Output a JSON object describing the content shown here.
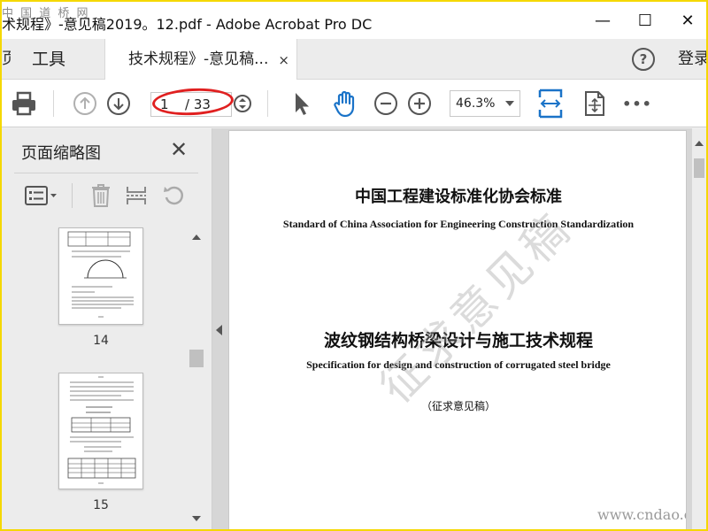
{
  "watermark_site_top": "中 国 道 桥 网",
  "window": {
    "title": "术规程》-意见稿2019。12.pdf - Adobe Acrobat Pro DC",
    "minimize_glyph": "—",
    "maximize_glyph": "☐",
    "close_glyph": "✕"
  },
  "tabs": {
    "home_partial": "页",
    "tools": "工具",
    "document": "技术规程》-意见稿...",
    "close_glyph": "×",
    "help_glyph": "?",
    "login": "登录"
  },
  "toolbar": {
    "icons": [
      "print-icon",
      "page-up-icon",
      "page-down-icon",
      "select-pointer-icon",
      "hand-icon",
      "zoom-out-icon",
      "zoom-in-icon",
      "fit-width-icon",
      "fit-page-icon",
      "more-icon"
    ],
    "current_page": "1",
    "total_pages": "/ 33",
    "zoom": "46.3%",
    "more_glyph": "•••",
    "annotation_color": "#e02020",
    "accent_color": "#1a73c8"
  },
  "sidebar": {
    "title": "页面缩略图",
    "close_glyph": "✕",
    "thumbnails": [
      {
        "label": "14"
      },
      {
        "label": "15"
      }
    ]
  },
  "document": {
    "org_cn": "中国工程建设标准化协会标准",
    "org_en": "Standard of China Association for Engineering Construction Standardization",
    "title_cn": "波纹钢结构桥梁设计与施工技术规程",
    "title_en": "Specification for design and construction of corrugated steel bridge",
    "draft_note": "（征求意见稿）",
    "watermark": "征求意见稿",
    "site_watermark": "www.cndao.com"
  }
}
